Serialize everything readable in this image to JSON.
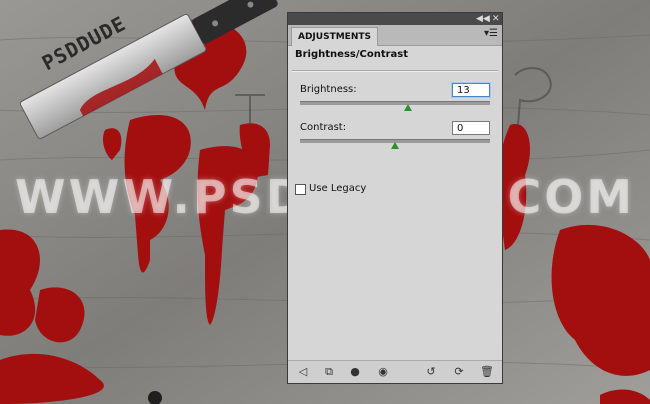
{
  "canvas": {
    "watermark": "WWW.PSD-DUDE.COM",
    "knife_text": "PSDDUDE"
  },
  "panel": {
    "tab_label": "ADJUSTMENTS",
    "adjustment_title": "Brightness/Contrast",
    "brightness": {
      "label": "Brightness:",
      "value": "13",
      "slider_level": 0.57
    },
    "contrast": {
      "label": "Contrast:",
      "value": "0",
      "slider_level": 0.5
    },
    "use_legacy": {
      "label": "Use Legacy",
      "checked": false
    },
    "footer_icons": [
      "return-arrow-icon",
      "expand-view-icon",
      "clip-layer-icon",
      "visibility-eye-icon",
      "previous-state-icon",
      "reset-icon",
      "trash-icon"
    ]
  },
  "colors": {
    "blood": "#a30f0f",
    "wood": "#8c8a86",
    "panel_bg": "#d6d6d6",
    "slider_thumb": "#2f8f2f",
    "focus": "#4a86c8"
  }
}
